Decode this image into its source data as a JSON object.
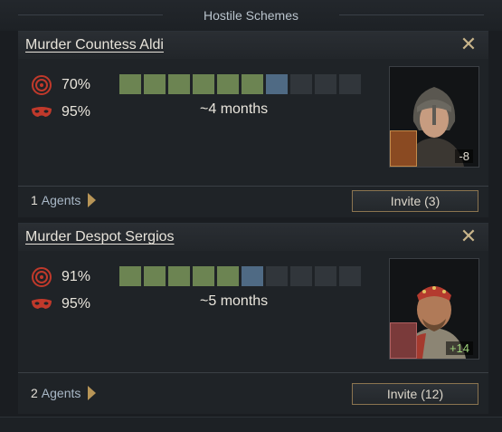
{
  "header": {
    "title": "Hostile Schemes"
  },
  "schemes": [
    {
      "title": "Murder Countess Aldi",
      "success_chance": "70%",
      "secrecy": "95%",
      "progress": {
        "total": 10,
        "completed": 6,
        "current_index": 6
      },
      "eta": "~4 months",
      "portrait_opinion": "-8",
      "agents_count": "1",
      "agents_label": "Agents",
      "invite_label": "Invite (3)"
    },
    {
      "title": "Murder Despot Sergios",
      "success_chance": "91%",
      "secrecy": "95%",
      "progress": {
        "total": 10,
        "completed": 5,
        "current_index": 5
      },
      "eta": "~5 months",
      "portrait_opinion": "+14",
      "agents_count": "2",
      "agents_label": "Agents",
      "invite_label": "Invite (12)"
    }
  ],
  "colors": {
    "progress_done": "#6c8452",
    "progress_current": "#4f6a84",
    "progress_empty": "#31363b",
    "accent_gold": "#b89557"
  }
}
